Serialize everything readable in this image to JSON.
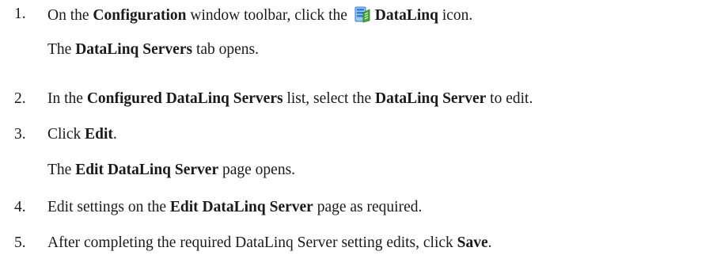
{
  "steps": [
    {
      "number": "1.",
      "parts": {
        "a": "On the ",
        "b": "Configuration",
        "c": " window toolbar, click the ",
        "d": "DataLinq",
        "e": " icon."
      },
      "icon": "dataling-server-icon",
      "result": {
        "a": "The ",
        "b": "DataLinq Servers",
        "c": " tab opens."
      }
    },
    {
      "number": "2.",
      "parts": {
        "a": "In the ",
        "b": "Configured DataLinq Servers",
        "c": " list, select the ",
        "d": "DataLinq Server",
        "e": " to edit."
      }
    },
    {
      "number": "3.",
      "parts": {
        "a": "Click ",
        "b": "Edit",
        "c": "."
      },
      "result": {
        "a": "The ",
        "b": "Edit DataLinq Server",
        "c": " page opens."
      }
    },
    {
      "number": "4.",
      "parts": {
        "a": "Edit settings on the ",
        "b": "Edit DataLinq Server",
        "c": " page as required."
      }
    },
    {
      "number": "5.",
      "parts": {
        "a": "After completing the required DataLinq Server setting edits, click ",
        "b": "Save",
        "c": "."
      }
    }
  ],
  "colors": {
    "text": "#1a1a1a",
    "icon_blue": "#2f7bd6",
    "icon_green": "#4aa83a"
  }
}
